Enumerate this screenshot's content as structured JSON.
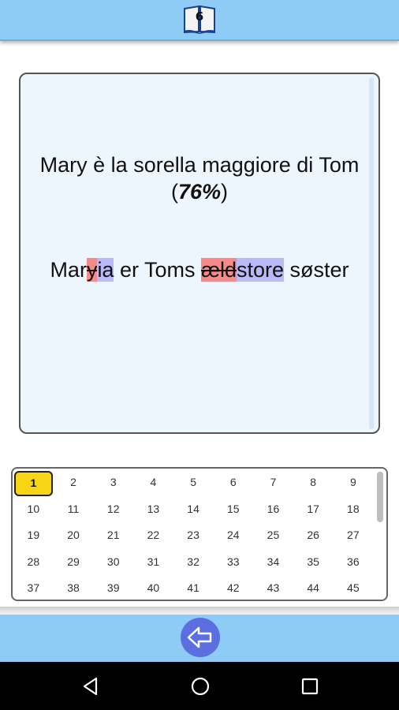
{
  "header": {
    "lesson_number": "6",
    "icon": "book-icon"
  },
  "card": {
    "prompt": "Mary è la sorella maggiore di Tom",
    "score_open": "(",
    "score_value": "76%",
    "score_close": ")",
    "answer_segments": [
      {
        "text": "Mar",
        "type": "same"
      },
      {
        "text": "y",
        "type": "del"
      },
      {
        "text": "ia",
        "type": "ins"
      },
      {
        "text": " er Toms ",
        "type": "same"
      },
      {
        "text": "æld",
        "type": "del"
      },
      {
        "text": "store",
        "type": "ins"
      },
      {
        "text": " søster",
        "type": "same"
      }
    ],
    "colors": {
      "deleted": "#f58a8a",
      "inserted": "#b9b9f8"
    }
  },
  "grid": {
    "selected": "1",
    "numbers": [
      "1",
      "2",
      "3",
      "4",
      "5",
      "6",
      "7",
      "8",
      "9",
      "10",
      "11",
      "12",
      "13",
      "14",
      "15",
      "16",
      "17",
      "18",
      "19",
      "20",
      "21",
      "22",
      "23",
      "24",
      "25",
      "26",
      "27",
      "28",
      "29",
      "30",
      "31",
      "32",
      "33",
      "34",
      "35",
      "36",
      "37",
      "38",
      "39",
      "40",
      "41",
      "42",
      "43",
      "44",
      "45"
    ]
  },
  "footer": {
    "back_icon": "back-arrow-icon"
  },
  "nav": {
    "icons": [
      "nav-back-icon",
      "nav-home-icon",
      "nav-recents-icon"
    ]
  },
  "theme": {
    "bar": "#8ecbf5",
    "button": "#5b6fe0",
    "highlight": "#f7d416"
  }
}
